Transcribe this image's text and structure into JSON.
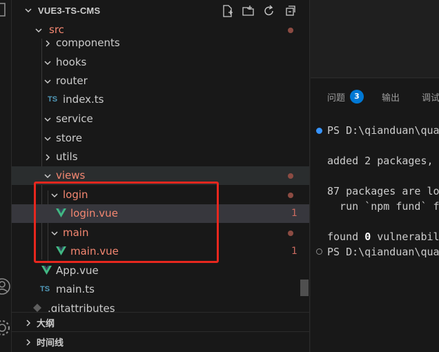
{
  "explorer": {
    "title": "VUE3-TS-CMS"
  },
  "tree": {
    "src": "src",
    "components": "components",
    "hooks": "hooks",
    "router": "router",
    "index_ts": "index.ts",
    "service": "service",
    "store": "store",
    "utils": "utils",
    "views": "views",
    "login": "login",
    "login_vue": "login.vue",
    "login_vue_badge": "1",
    "main": "main",
    "main_vue": "main.vue",
    "main_vue_badge": "1",
    "app_vue": "App.vue",
    "main_ts": "main.ts",
    "gitattributes": ".gitattributes",
    "ts_icon_label": "TS"
  },
  "sections": {
    "outline": "大纲",
    "timeline": "时间线"
  },
  "panel": {
    "tabs": [
      "问题",
      "输出",
      "调试"
    ],
    "problems_count": "3"
  },
  "terminal": {
    "lines": [
      "PS D:\\qianduan\\qua",
      "added 2 packages,",
      "87 packages are lo",
      "  run `npm fund` f",
      "found ",
      "0",
      " vulnerabil",
      "PS D:\\qianduan\\qua"
    ]
  },
  "colors": {
    "accent": "#0078d4",
    "git_modified": "#f48771",
    "highlight_box": "#e8271e",
    "vue_green": "#41b883",
    "ts_blue": "#519aba"
  }
}
